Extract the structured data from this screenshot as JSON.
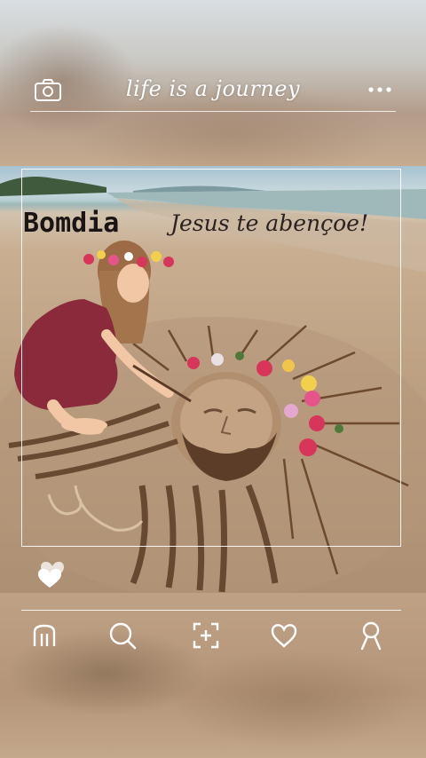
{
  "header": {
    "title": "life is a journey",
    "left_icon": "camera-icon",
    "right_icon": "more-icon"
  },
  "post": {
    "greeting": "Bomdia",
    "blessing": "Jesus te abençoe!",
    "like_icon": "heart-icon",
    "colors": {
      "sand": "#bb9e80",
      "sky": "#a7c2d1",
      "dress": "#8a2a3a"
    }
  },
  "nav": {
    "items": [
      {
        "icon": "home-icon"
      },
      {
        "icon": "search-icon"
      },
      {
        "icon": "add-icon"
      },
      {
        "icon": "heart-icon"
      },
      {
        "icon": "profile-icon"
      }
    ]
  }
}
